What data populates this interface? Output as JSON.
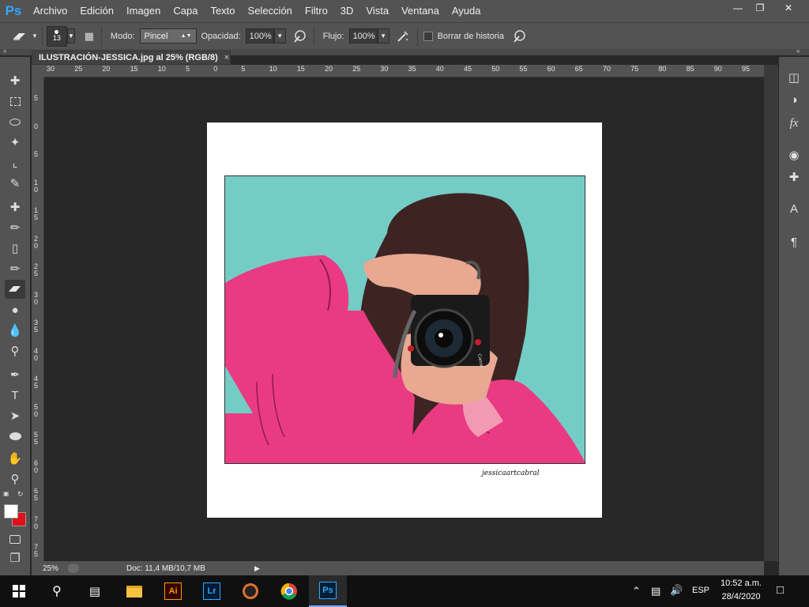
{
  "app": {
    "logo": "Ps"
  },
  "menu": [
    "Archivo",
    "Edición",
    "Imagen",
    "Capa",
    "Texto",
    "Selección",
    "Filtro",
    "3D",
    "Vista",
    "Ventana",
    "Ayuda"
  ],
  "options": {
    "brush_size": "13",
    "mode_label": "Modo:",
    "mode_value": "Pincel",
    "opacity_label": "Opacidad:",
    "opacity_value": "100%",
    "flow_label": "Flujo:",
    "flow_value": "100%",
    "erase_history_label": "Borrar de historia"
  },
  "document": {
    "tab_title": "ILUSTRACIÓN-JESSICA.jpg al 25% (RGB/8)",
    "close_glyph": "×",
    "signature": "jessicaartcabral",
    "camera_brand": "Canon"
  },
  "ruler": {
    "h_labels": [
      "30",
      "25",
      "20",
      "15",
      "10",
      "5",
      "0",
      "5",
      "10",
      "15",
      "20",
      "25",
      "30",
      "35",
      "40",
      "45",
      "50",
      "55",
      "60",
      "65",
      "70",
      "75",
      "80",
      "85",
      "90",
      "95"
    ],
    "v_labels": [
      "5",
      "0",
      "5",
      "1 0",
      "1 5",
      "2 0",
      "2 5",
      "3 0",
      "3 5",
      "4 0",
      "4 5",
      "5 0",
      "5 5",
      "6 0",
      "6 5",
      "7 0",
      "7 5"
    ]
  },
  "status": {
    "zoom": "25%",
    "doc": "Doc: 11,4 MB/10,7 MB"
  },
  "taskbar": {
    "lang": "ESP",
    "time": "10:52 a.m.",
    "date": "28/4/2020"
  },
  "colors": {
    "foreground": "#ffffff",
    "background": "#e0101a",
    "canvas_bg": "#74ccc6",
    "sweater": "#ea3b82",
    "ps_blue": "#31a8ff"
  },
  "icons": {
    "tools": [
      "move-icon",
      "marquee-icon",
      "lasso-icon",
      "magic-wand-icon",
      "crop-icon",
      "eyedropper-icon",
      "healing-brush-icon",
      "brush-icon",
      "clone-stamp-icon",
      "history-brush-icon",
      "eraser-icon",
      "paint-bucket-icon",
      "blur-icon",
      "dodge-icon",
      "pen-icon",
      "type-icon",
      "path-selection-icon",
      "ellipse-icon",
      "hand-icon",
      "zoom-icon"
    ],
    "panels": [
      "layers-icon",
      "adjustments-icon",
      "styles-icon",
      "channels-icon",
      "paths-icon",
      "character-icon",
      "paragraph-icon"
    ]
  }
}
